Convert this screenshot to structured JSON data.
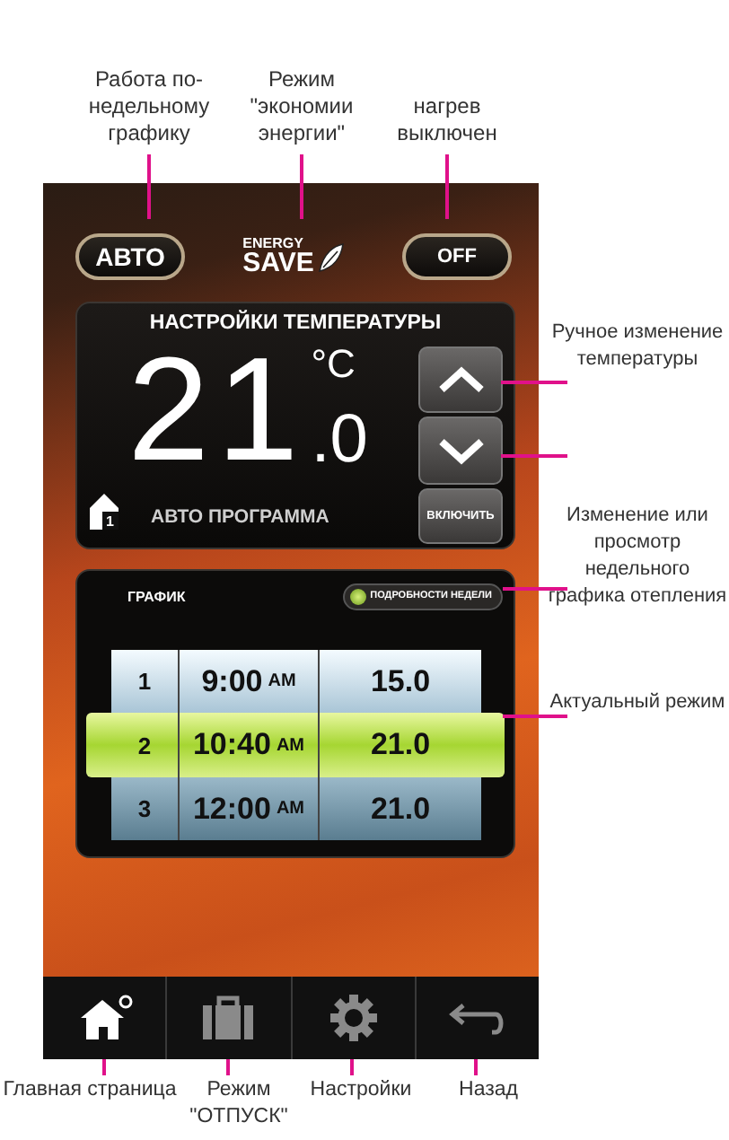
{
  "annotations": {
    "top": [
      {
        "text": "Работа по-недельному графику"
      },
      {
        "text": "Режим \"экономии энергии\""
      },
      {
        "text": "нагрев выключен"
      }
    ],
    "right": [
      {
        "text": "Ручное изменение температуры"
      },
      {
        "text": "Изменение или просмотр недельного графика отепления"
      },
      {
        "text": "Актуальный режим"
      }
    ],
    "bottom": [
      {
        "text": "Главная страница"
      },
      {
        "text": "Режим \"ОТПУСК\""
      },
      {
        "text": "Настройки"
      },
      {
        "text": "Назад"
      }
    ]
  },
  "header": {
    "mode_button": "АВТО",
    "logo_top": "ENERGY",
    "logo_bottom": "SAVE",
    "power_button": "OFF"
  },
  "temperature_panel": {
    "title": "НАСТРОЙКИ ТЕМПЕРАТУРЫ",
    "whole": "21",
    "unit": "°C",
    "decimal": ".0",
    "zone": "1",
    "program": "АВТО ПРОГРАММА",
    "enable_button": "ВКЛЮЧИТЬ"
  },
  "schedule": {
    "title": "ГРАФИК",
    "details_button": "ПОДРОБНОСТИ НЕДЕЛИ",
    "rows": [
      {
        "number": "1",
        "time": "9:00",
        "period": "AM",
        "temperature": "15.0",
        "selected": false
      },
      {
        "number": "2",
        "time": "10:40",
        "period": "AM",
        "temperature": "21.0",
        "selected": true
      },
      {
        "number": "3",
        "time": "12:00",
        "period": "AM",
        "temperature": "21.0",
        "selected": false
      }
    ]
  },
  "nav": [
    {
      "kind": "home",
      "selected": true
    },
    {
      "kind": "suitcase",
      "selected": false
    },
    {
      "kind": "gear",
      "selected": false
    },
    {
      "kind": "back",
      "selected": false
    }
  ]
}
